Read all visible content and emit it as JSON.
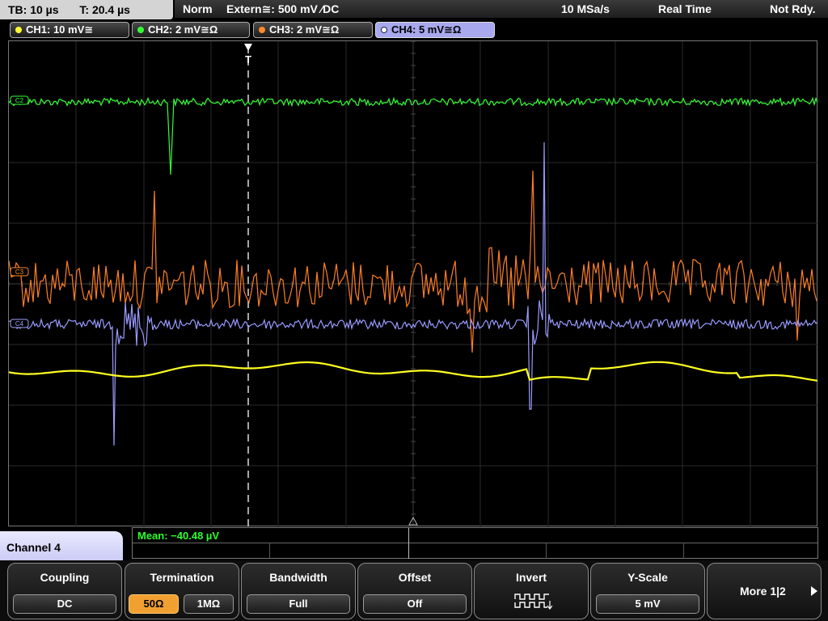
{
  "topbar": {
    "timebase": "TB: 10 µs",
    "trigger_time": "T: 20.4 µs",
    "trigger_mode": "Norm",
    "trigger_source": "Extern≅: 500 mV ⁄DC",
    "sample_rate": "10 MSa/s",
    "acq_mode": "Real Time",
    "status": "Not Rdy."
  },
  "channels": [
    {
      "label": "CH1: 10 mV≅",
      "color": "#ffff33"
    },
    {
      "label": "CH2: 2 mV≅Ω",
      "color": "#33ff33"
    },
    {
      "label": "CH3: 2 mV≅Ω",
      "color": "#ff8a2a"
    },
    {
      "label": "CH4: 5 mV≅Ω",
      "color": "#a0a0ff"
    }
  ],
  "screen": {
    "trigger_marker": "T",
    "ch2_marker": "C2",
    "ch3_marker": "C3",
    "ch4_marker": "C4"
  },
  "measurement": {
    "mean": "Mean: −40.48 µV"
  },
  "menu": {
    "title": "Channel 4",
    "coupling": {
      "title": "Coupling",
      "value": "DC"
    },
    "termination": {
      "title": "Termination",
      "opt1": "50Ω",
      "opt2": "1MΩ"
    },
    "bandwidth": {
      "title": "Bandwidth",
      "value": "Full"
    },
    "offset": {
      "title": "Offset",
      "value": "Off"
    },
    "invert": {
      "title": "Invert",
      "icon": "invert-wave-icon"
    },
    "yscale": {
      "title": "Y-Scale",
      "value": "5 mV"
    },
    "more": {
      "label": "More 1|2"
    }
  }
}
